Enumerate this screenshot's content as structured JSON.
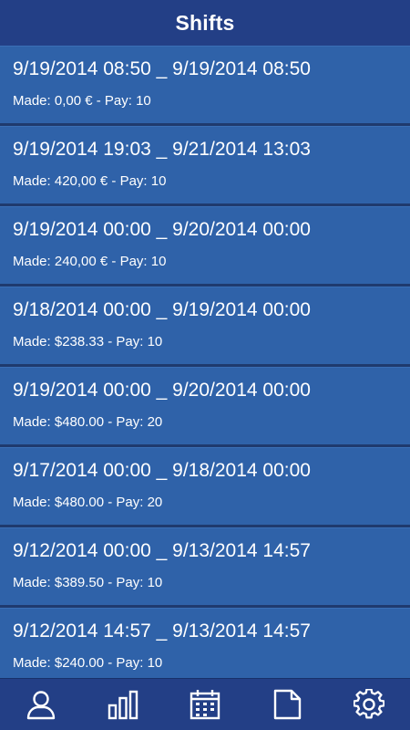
{
  "header": {
    "title": "Shifts"
  },
  "shifts": [
    {
      "range": "9/19/2014 08:50 _ 9/19/2014 08:50",
      "meta": "Made: 0,00 € - Pay: 10"
    },
    {
      "range": "9/19/2014 19:03 _ 9/21/2014 13:03",
      "meta": "Made: 420,00 € - Pay: 10"
    },
    {
      "range": "9/19/2014 00:00 _ 9/20/2014 00:00",
      "meta": "Made: 240,00 € - Pay: 10"
    },
    {
      "range": "9/18/2014 00:00 _ 9/19/2014 00:00",
      "meta": "Made: $238.33 - Pay: 10"
    },
    {
      "range": "9/19/2014 00:00 _ 9/20/2014 00:00",
      "meta": "Made: $480.00 - Pay: 20"
    },
    {
      "range": "9/17/2014 00:00 _ 9/18/2014 00:00",
      "meta": "Made: $480.00 - Pay: 20"
    },
    {
      "range": "9/12/2014 00:00 _ 9/13/2014 14:57",
      "meta": "Made: $389.50 - Pay: 10"
    },
    {
      "range": "9/12/2014 14:57 _ 9/13/2014 14:57",
      "meta": "Made: $240.00 - Pay: 10"
    }
  ],
  "tabbar": {
    "tabs": [
      {
        "icon": "person-icon"
      },
      {
        "icon": "bar-chart-icon"
      },
      {
        "icon": "calendar-icon"
      },
      {
        "icon": "document-icon"
      },
      {
        "icon": "gear-icon"
      }
    ]
  },
  "colors": {
    "header_bg": "#233f86",
    "item_bg": "#2f62a9",
    "separator": "#1f3a6e",
    "text": "#ffffff"
  }
}
